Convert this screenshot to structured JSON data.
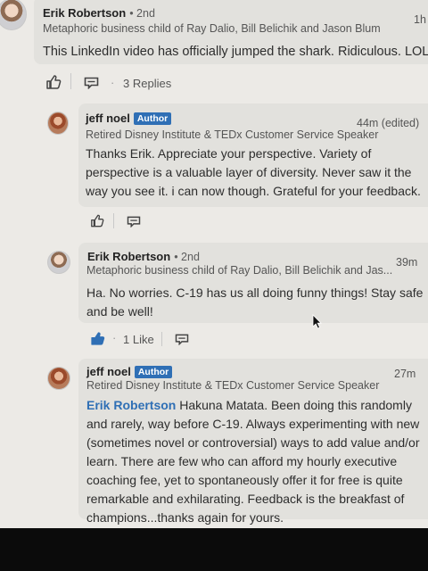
{
  "comment1": {
    "author": "Erik Robertson",
    "degree": "• 2nd",
    "headline": "Metaphoric business child of Ray Dalio, Bill Belichik and Jason Blum",
    "time": "1h",
    "text": "This LinkedIn video has officially jumped the shark. Ridiculous. LOL!",
    "separator": "·",
    "replies": "3 Replies"
  },
  "reply1": {
    "author": "jeff noel",
    "badge": "Author",
    "headline": "Retired Disney Institute & TEDx Customer Service Speaker",
    "time": "44m (edited)",
    "text": "Thanks Erik. Appreciate your perspective. Variety of perspective is a valuable layer of diversity. Never saw it the way you see it. i can now though. Grateful for your feedback."
  },
  "reply2": {
    "author": "Erik Robertson",
    "degree": "• 2nd",
    "headline": "Metaphoric business child of Ray Dalio, Bill Belichik and Jas...",
    "time": "39m",
    "text": "Ha. No worries. C-19 has us all doing funny things! Stay safe and be well!",
    "separator": "·",
    "likes": "1 Like"
  },
  "reply3": {
    "author": "jeff noel",
    "badge": "Author",
    "headline": "Retired Disney Institute & TEDx Customer Service Speaker",
    "time": "27m",
    "mention": "Erik Robertson",
    "text": " Hakuna Matata. Been doing this randomly and rarely, way before C-19. Always experimenting with new (sometimes novel or controversial) ways to add value and/or learn. There are few who can afford my hourly executive coaching fee, yet to spontaneously offer it for free is quite remarkable and exhilarating. Feedback is the breakfast of champions...thanks again for yours."
  },
  "icons": {
    "like": "thumbs-up-outline-icon",
    "liked": "thumbs-up-filled-icon",
    "comment": "comment-icon",
    "cursor": "mouse-pointer-icon"
  },
  "colors": {
    "accent": "#2f6fb5",
    "bubble": "#e2e1dd",
    "background": "#eceae6"
  }
}
